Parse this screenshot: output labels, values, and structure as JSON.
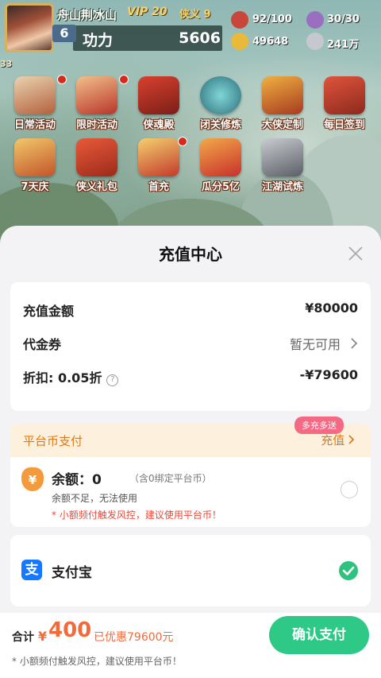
{
  "game": {
    "player_name": "舟山荆冰山",
    "vip_label": "VIP 20",
    "xiayi_label": "侠义 9",
    "level": "6",
    "power_label": "功力",
    "power_value": "5606",
    "resources": [
      {
        "icon": "stamina-icon",
        "value": "92/100"
      },
      {
        "icon": "energy-icon",
        "value": "30/30"
      },
      {
        "icon": "gold-ingot-icon",
        "value": "49648"
      },
      {
        "icon": "silver-icon",
        "value": "241万"
      }
    ],
    "side_badge": "33",
    "activities_row1": [
      {
        "icon": "daily-activity-icon",
        "label": "日常活动"
      },
      {
        "icon": "limited-activity-icon",
        "label": "限时活动"
      },
      {
        "icon": "hero-hall-icon",
        "label": "侠魂殿"
      },
      {
        "icon": "seclusion-training-icon",
        "label": "闭关修炼"
      },
      {
        "icon": "hero-customize-icon",
        "label": "大侠定制"
      },
      {
        "icon": "daily-signin-icon",
        "label": "每日签到"
      }
    ],
    "activities_row2": [
      {
        "icon": "seven-day-icon",
        "label": "7天庆"
      },
      {
        "icon": "gift-pack-icon",
        "label": "侠义礼包"
      },
      {
        "icon": "first-recharge-icon",
        "label": "首充"
      },
      {
        "icon": "split-5b-icon",
        "label": "瓜分5亿"
      },
      {
        "icon": "jianghu-trial-icon",
        "label": "江湖试炼"
      }
    ]
  },
  "payment": {
    "title": "充值中心",
    "summary": {
      "amount_label": "充值金额",
      "amount_value": "¥80000",
      "voucher_label": "代金券",
      "voucher_value": "暂无可用",
      "discount_label": "折扣: 0.05折",
      "discount_value": "-¥79600"
    },
    "platform": {
      "title": "平台币支付",
      "recharge_label": "充值",
      "promo_badge": "多充多送",
      "balance_label": "余额：",
      "balance_value": "0",
      "balance_note": "（含0绑定平台币）",
      "insufficient": "余额不足，无法使用",
      "warning": "* 小额频付触发风控，建议使用平台币！"
    },
    "alipay": {
      "label": "支付宝",
      "icon_char": "支"
    },
    "footer": {
      "total_label": "合计",
      "currency": "¥",
      "total_value": "400",
      "discount_text": "已优惠79600元",
      "note": "* 小额频付触发风控，建议使用平台币！",
      "confirm_label": "确认支付"
    }
  },
  "colors": {
    "accent_green": "#2ec986",
    "accent_orange": "#f26a3a",
    "alipay_blue": "#1677ff",
    "promo_pink": "#f46a85"
  }
}
